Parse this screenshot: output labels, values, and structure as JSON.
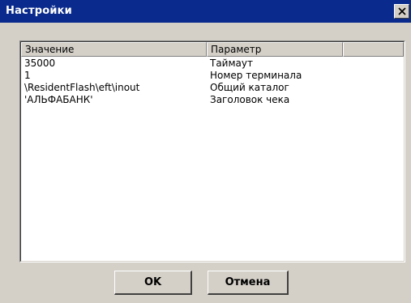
{
  "window": {
    "title": "Настройки",
    "close_icon": "close-icon"
  },
  "table": {
    "columns": [
      "Значение",
      "Параметр",
      ""
    ],
    "rows": [
      {
        "value": "35000",
        "param": "Таймаут"
      },
      {
        "value": "1",
        "param": "Номер терминала"
      },
      {
        "value": "\\ResidentFlash\\eft\\inout",
        "param": "Общий каталог"
      },
      {
        "value": "'АЛЬФАБАНК'",
        "param": "Заголовок чека"
      }
    ]
  },
  "buttons": {
    "ok_label": "OK",
    "cancel_label": "Отмена"
  },
  "colors": {
    "titlebar": "#0a2b8d",
    "face": "#d4d0c8"
  }
}
